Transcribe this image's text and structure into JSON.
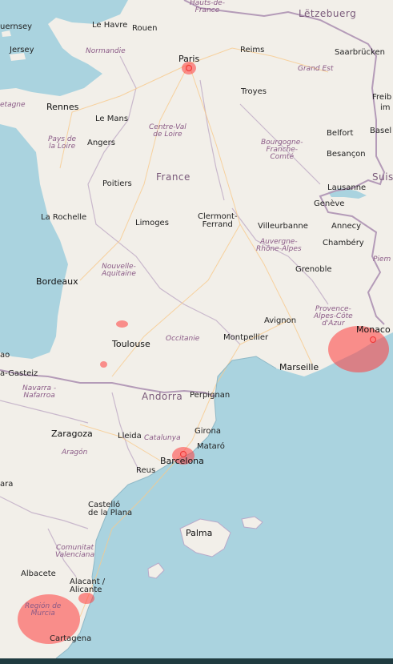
{
  "map": {
    "labels": {
      "hauts_de_france": "Hauts-de-\nFrance",
      "letzebuerg": "Lëtzebuerg",
      "guernsey": "uernsey",
      "jersey": "Jersey",
      "le_havre": "Le Havre",
      "rouen": "Rouen",
      "normandie": "Normandie",
      "paris": "Paris",
      "reims": "Reims",
      "saarbrucken": "Saarbrücken",
      "grand_est": "Grand Est",
      "bretagne": "etagne",
      "rennes": "Rennes",
      "le_mans": "Le Mans",
      "troyes": "Troyes",
      "freib": "Freib",
      "im": "im",
      "centre_val_de_loire": "Centre-Val\nde Loire",
      "pays_de_la_loire": "Pays de\nla Loire",
      "angers": "Angers",
      "basel": "Basel",
      "belfort": "Belfort",
      "bourgogne": "Bourgogne-\nFranche-\nComté",
      "besancon": "Besançon",
      "france": "France",
      "suis": "Suis",
      "poitiers": "Poitiers",
      "lausanne": "Lausanne",
      "la_rochelle": "La Rochelle",
      "geneve": "Genève",
      "limoges": "Limoges",
      "clermont": "Clermont-\nFerrand",
      "villeurbanne": "Villeurbanne",
      "annecy": "Annecy",
      "chambery": "Chambéry",
      "auvergne": "Auvergne-\nRhône-Alpes",
      "nouvelle_aquitaine": "Nouvelle-\nAquitaine",
      "piem": "Piem",
      "bordeaux": "Bordeaux",
      "grenoble": "Grenoble",
      "provence": "Provence-\nAlpes-Côte\nd'Azur",
      "avignon": "Avignon",
      "monaco": "Monaco",
      "toulouse": "Toulouse",
      "occitanie": "Occitanie",
      "montpellier": "Montpellier",
      "marseille": "Marseille",
      "ao": "ao",
      "gasteiz": "a-Gasteiz",
      "navarra": "Navarra -\nNafarroa",
      "andorra": "Andorra",
      "perpignan": "Perpignan",
      "zaragoza": "Zaragoza",
      "lleida": "Lleida",
      "girona": "Girona",
      "catalunya": "Catalunya",
      "mataro": "Mataró",
      "aragon": "Aragón",
      "barcelona": "Barcelona",
      "reus": "Reus",
      "ara": "ara",
      "castello": "Castelló\nde la Plana",
      "palma": "Palma",
      "comunitat": "Comunitat\nValenciana",
      "albacete": "Albacete",
      "alacant": "Alacant /\nAlicante",
      "murcia": "Región de\nMurcia",
      "cartagena": "Cartagena"
    }
  },
  "heatmap": {
    "color": "#ff3c3c",
    "hotspots": [
      {
        "name": "Paris"
      },
      {
        "name": "Monaco"
      },
      {
        "name": "Barcelona"
      },
      {
        "name": "Región de Murcia"
      },
      {
        "name": "Alicante"
      },
      {
        "name": "Toulouse"
      },
      {
        "name": "Pyrenees"
      }
    ]
  }
}
